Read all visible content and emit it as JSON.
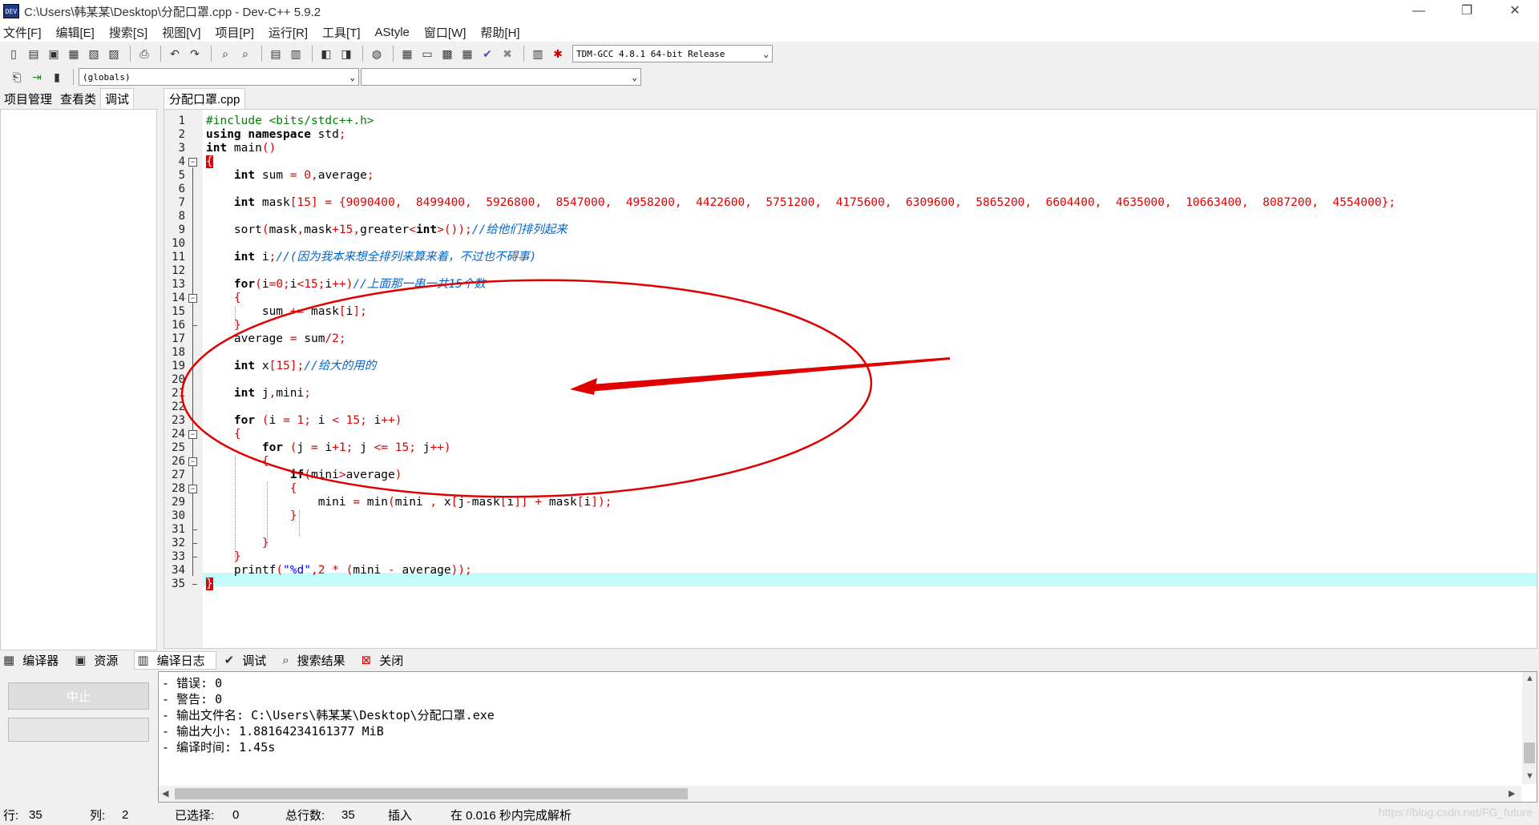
{
  "window": {
    "title": "C:\\Users\\韩某某\\Desktop\\分配口罩.cpp - Dev-C++ 5.9.2",
    "app_icon": "DEV"
  },
  "menu": [
    "文件[F]",
    "编辑[E]",
    "搜索[S]",
    "视图[V]",
    "项目[P]",
    "运行[R]",
    "工具[T]",
    "AStyle",
    "窗口[W]",
    "帮助[H]"
  ],
  "toolbar": {
    "compiler": "TDM-GCC 4.8.1 64-bit Release",
    "scope": "(globals)"
  },
  "left_tabs": [
    "项目管理",
    "查看类",
    "调试"
  ],
  "editor_tab": "分配口罩.cpp",
  "code": {
    "line_numbers": [
      "1",
      "2",
      "3",
      "4",
      "5",
      "6",
      "7",
      "8",
      "9",
      "10",
      "11",
      "12",
      "13",
      "14",
      "15",
      "16",
      "17",
      "18",
      "19",
      "20",
      "21",
      "22",
      "23",
      "24",
      "25",
      "26",
      "27",
      "28",
      "29",
      "30",
      "31",
      "32",
      "33",
      "34",
      "35"
    ],
    "l1_a": "#include ",
    "l1_b": "<bits/stdc++.h>",
    "l2_a": "using namespace",
    "l2_b": " std",
    "l2_c": ";",
    "l3_a": "int",
    "l3_b": " main",
    "l3_c": "()",
    "l4": "{",
    "l5_a": "int",
    "l5_b": " sum ",
    "l5_c": "=",
    "l5_d": " 0",
    "l5_e": ",",
    "l5_f": "average",
    "l5_g": ";",
    "l7_a": "int",
    "l7_b": " mask",
    "l7_c": "[15]",
    "l7_d": " = {",
    "l7_e": "9090400,  8499400,  5926800,  8547000,  4958200,  4422600,  5751200,  4175600,  6309600,  5865200,  6604400,  4635000,  10663400,  8087200,  4554000",
    "l7_f": "};",
    "l9_a": "sort",
    "l9_b": "(",
    "l9_c": "mask",
    "l9_d": ",",
    "l9_e": "mask",
    "l9_f": "+15",
    "l9_g": ",",
    "l9_h": "greater",
    "l9_i": "<",
    "l9_j": "int",
    "l9_k": ">());",
    "l9_l": "//给他们排列起来",
    "l11_a": "int",
    "l11_b": " i",
    "l11_c": ";",
    "l11_d": "//(因为我本来想全排列来算来着，不过也不碍事)",
    "l13_a": "for",
    "l13_b": "(",
    "l13_c": "i",
    "l13_d": "=0;",
    "l13_e": "i",
    "l13_f": "<15;",
    "l13_g": "i",
    "l13_h": "++)",
    "l13_i": "//上面那一串一共15个数",
    "l14": "{",
    "l15_a": "sum ",
    "l15_b": "+=",
    "l15_c": " mask",
    "l15_d": "[",
    "l15_e": "i",
    "l15_f": "];",
    "l16": "}",
    "l17_a": "average ",
    "l17_b": "=",
    "l17_c": " sum",
    "l17_d": "/2;",
    "l19_a": "int",
    "l19_b": " x",
    "l19_c": "[15];",
    "l19_d": "//给大的用的",
    "l21_a": "int",
    "l21_b": " j",
    "l21_c": ",",
    "l21_d": "mini",
    "l21_e": ";",
    "l23_a": "for",
    "l23_b": " (",
    "l23_c": "i ",
    "l23_d": "= 1;",
    "l23_e": " i ",
    "l23_f": "< 15;",
    "l23_g": " i",
    "l23_h": "++)",
    "l24": "{",
    "l25_a": "for",
    "l25_b": " (",
    "l25_c": "j ",
    "l25_d": "=",
    "l25_e": " i",
    "l25_f": "+1;",
    "l25_g": " j ",
    "l25_h": "<= 15;",
    "l25_i": " j",
    "l25_j": "++)",
    "l26": "{",
    "l27_a": "if",
    "l27_b": "(",
    "l27_c": "mini",
    "l27_d": ">",
    "l27_e": "average",
    "l27_f": ")",
    "l28": "{",
    "l29_a": "mini ",
    "l29_b": "=",
    "l29_c": " min",
    "l29_d": "(",
    "l29_e": "mini ",
    "l29_f": ",",
    "l29_g": " x",
    "l29_h": "[",
    "l29_i": "j",
    "l29_j": "-",
    "l29_k": "mask",
    "l29_l": "[",
    "l29_m": "i",
    "l29_n": "]]",
    "l29_o": " +",
    "l29_p": " mask",
    "l29_q": "[",
    "l29_r": "i",
    "l29_s": "]);",
    "l30": "}",
    "l32": "}",
    "l33": "}",
    "l34_a": "printf",
    "l34_b": "(",
    "l34_c": "\"%d\"",
    "l34_d": ",2 *",
    "l34_e": " (",
    "l34_f": "mini ",
    "l34_g": "-",
    "l34_h": " average",
    "l34_i": "));",
    "l35": "}"
  },
  "bottom_tabs": [
    "编译器",
    "资源",
    "编译日志",
    "调试",
    "搜索结果",
    "关闭"
  ],
  "stop_button": "中止",
  "log_lines": [
    "- 错误: 0",
    "- 警告: 0",
    "- 输出文件名: C:\\Users\\韩某某\\Desktop\\分配口罩.exe",
    "- 输出大小: 1.88164234161377 MiB",
    "- 编译时间: 1.45s"
  ],
  "status": {
    "row_label": "行:",
    "row_value": "35",
    "col_label": "列:",
    "col_value": "2",
    "sel_label": "已选择:",
    "sel_value": "0",
    "total_label": "总行数:",
    "total_value": "35",
    "mode": "插入",
    "parse": "在 0.016 秒内完成解析"
  },
  "watermark": "https://blog.csdn.net/FG_future",
  "colors": {
    "annotation": "#e00000",
    "current_line": "#c6fbfd",
    "comment": "#0066cc"
  }
}
